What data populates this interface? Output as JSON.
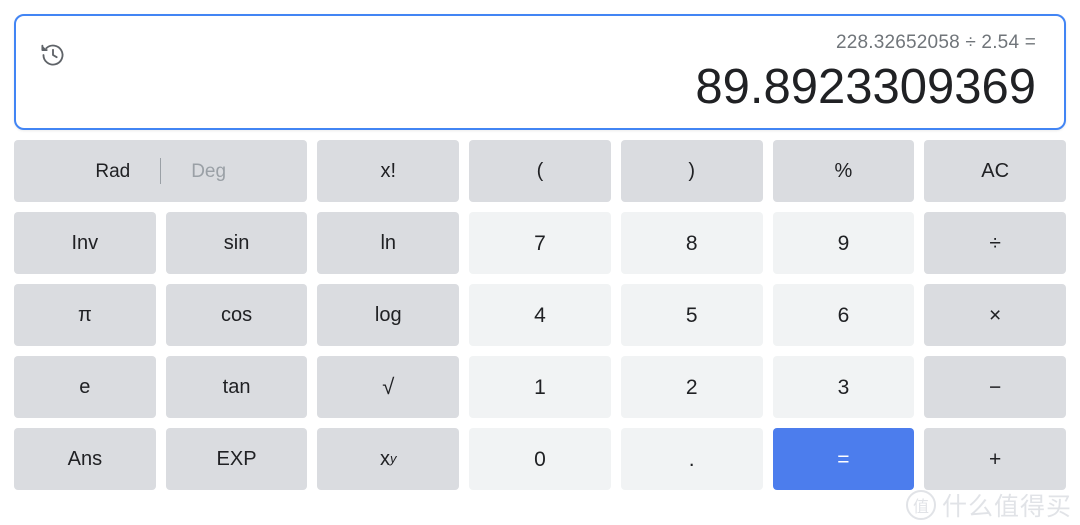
{
  "display": {
    "history_icon": "history-icon",
    "expression": "228.32652058 ÷ 2.54 =",
    "result": "89.8923309369",
    "border_color": "#4285f4"
  },
  "angle_mode": {
    "rad_label": "Rad",
    "deg_label": "Deg",
    "active": "Rad"
  },
  "colors": {
    "function_key": "#dadce0",
    "number_key": "#f1f3f4",
    "equals_key": "#4c7ded",
    "text": "#202124",
    "muted_text": "#9aa0a6"
  },
  "keys": {
    "row1": [
      {
        "label": "x!",
        "type": "func",
        "name": "key-factorial"
      },
      {
        "label": "(",
        "type": "func",
        "name": "key-open-paren"
      },
      {
        "label": ")",
        "type": "func",
        "name": "key-close-paren"
      },
      {
        "label": "%",
        "type": "func",
        "name": "key-percent"
      },
      {
        "label": "AC",
        "type": "func",
        "name": "key-all-clear"
      }
    ],
    "row2": [
      {
        "label": "Inv",
        "type": "func",
        "name": "key-inverse"
      },
      {
        "label": "sin",
        "type": "func",
        "name": "key-sin"
      },
      {
        "label": "ln",
        "type": "func",
        "name": "key-ln"
      },
      {
        "label": "7",
        "type": "num",
        "name": "key-7"
      },
      {
        "label": "8",
        "type": "num",
        "name": "key-8"
      },
      {
        "label": "9",
        "type": "num",
        "name": "key-9"
      },
      {
        "label": "÷",
        "type": "op",
        "name": "key-divide"
      }
    ],
    "row3": [
      {
        "label": "π",
        "type": "func",
        "name": "key-pi"
      },
      {
        "label": "cos",
        "type": "func",
        "name": "key-cos"
      },
      {
        "label": "log",
        "type": "func",
        "name": "key-log"
      },
      {
        "label": "4",
        "type": "num",
        "name": "key-4"
      },
      {
        "label": "5",
        "type": "num",
        "name": "key-5"
      },
      {
        "label": "6",
        "type": "num",
        "name": "key-6"
      },
      {
        "label": "×",
        "type": "op",
        "name": "key-multiply"
      }
    ],
    "row4": [
      {
        "label": "e",
        "type": "func",
        "name": "key-e"
      },
      {
        "label": "tan",
        "type": "func",
        "name": "key-tan"
      },
      {
        "label": "√",
        "type": "func",
        "name": "key-sqrt"
      },
      {
        "label": "1",
        "type": "num",
        "name": "key-1"
      },
      {
        "label": "2",
        "type": "num",
        "name": "key-2"
      },
      {
        "label": "3",
        "type": "num",
        "name": "key-3"
      },
      {
        "label": "−",
        "type": "op",
        "name": "key-minus"
      }
    ],
    "row5": [
      {
        "label": "Ans",
        "type": "func",
        "name": "key-answer"
      },
      {
        "label": "EXP",
        "type": "func",
        "name": "key-exp"
      },
      {
        "label": "x",
        "sup": "y",
        "type": "func",
        "name": "key-power"
      },
      {
        "label": "0",
        "type": "num",
        "name": "key-0"
      },
      {
        "label": ".",
        "type": "num",
        "name": "key-decimal"
      },
      {
        "label": "=",
        "type": "equals",
        "name": "key-equals"
      },
      {
        "label": "+",
        "type": "op",
        "name": "key-plus"
      }
    ]
  },
  "watermark": {
    "badge": "值",
    "text": "什么值得买"
  }
}
